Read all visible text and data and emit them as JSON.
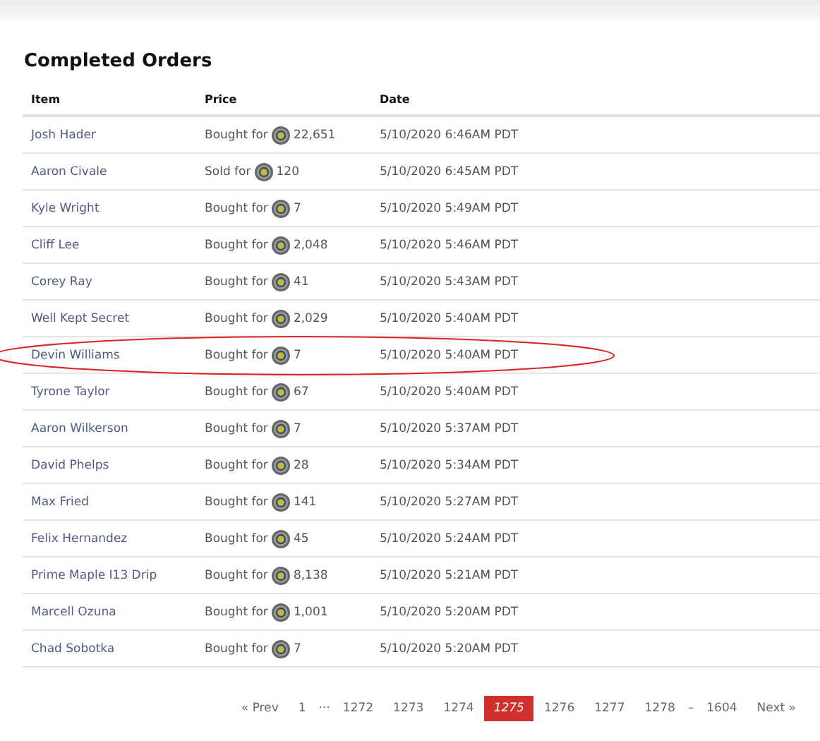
{
  "title": "Completed Orders",
  "table": {
    "columns": [
      "Item",
      "Price",
      "Date"
    ],
    "rows": [
      {
        "item": "Josh Hader",
        "action": "Bought for",
        "amount": "22,651",
        "date": "5/10/2020 6:46AM PDT",
        "highlighted": false
      },
      {
        "item": "Aaron Civale",
        "action": "Sold for",
        "amount": "120",
        "date": "5/10/2020 6:45AM PDT",
        "highlighted": false
      },
      {
        "item": "Kyle Wright",
        "action": "Bought for",
        "amount": "7",
        "date": "5/10/2020 5:49AM PDT",
        "highlighted": false
      },
      {
        "item": "Cliff Lee",
        "action": "Bought for",
        "amount": "2,048",
        "date": "5/10/2020 5:46AM PDT",
        "highlighted": false
      },
      {
        "item": "Corey Ray",
        "action": "Bought for",
        "amount": "41",
        "date": "5/10/2020 5:43AM PDT",
        "highlighted": false
      },
      {
        "item": "Well Kept Secret",
        "action": "Bought for",
        "amount": "2,029",
        "date": "5/10/2020 5:40AM PDT",
        "highlighted": false
      },
      {
        "item": "Devin Williams",
        "action": "Bought for",
        "amount": "7",
        "date": "5/10/2020 5:40AM PDT",
        "highlighted": true
      },
      {
        "item": "Tyrone Taylor",
        "action": "Bought for",
        "amount": "67",
        "date": "5/10/2020 5:40AM PDT",
        "highlighted": false
      },
      {
        "item": "Aaron Wilkerson",
        "action": "Bought for",
        "amount": "7",
        "date": "5/10/2020 5:37AM PDT",
        "highlighted": false
      },
      {
        "item": "David Phelps",
        "action": "Bought for",
        "amount": "28",
        "date": "5/10/2020 5:34AM PDT",
        "highlighted": false
      },
      {
        "item": "Max Fried",
        "action": "Bought for",
        "amount": "141",
        "date": "5/10/2020 5:27AM PDT",
        "highlighted": false
      },
      {
        "item": "Felix Hernandez",
        "action": "Bought for",
        "amount": "45",
        "date": "5/10/2020 5:24AM PDT",
        "highlighted": false
      },
      {
        "item": "Prime Maple I13 Drip",
        "action": "Bought for",
        "amount": "8,138",
        "date": "5/10/2020 5:21AM PDT",
        "highlighted": false
      },
      {
        "item": "Marcell Ozuna",
        "action": "Bought for",
        "amount": "1,001",
        "date": "5/10/2020 5:20AM PDT",
        "highlighted": false
      },
      {
        "item": "Chad Sobotka",
        "action": "Bought for",
        "amount": "7",
        "date": "5/10/2020 5:20AM PDT",
        "highlighted": false
      }
    ]
  },
  "pagination": [
    {
      "label": "« Prev",
      "kind": "link",
      "selected": false
    },
    {
      "label": "1",
      "kind": "page",
      "selected": false
    },
    {
      "label": "···",
      "kind": "gap"
    },
    {
      "label": "1272",
      "kind": "page",
      "selected": false
    },
    {
      "label": "1273",
      "kind": "page",
      "selected": false
    },
    {
      "label": "1274",
      "kind": "page",
      "selected": false
    },
    {
      "label": "1275",
      "kind": "page",
      "selected": true
    },
    {
      "label": "1276",
      "kind": "page",
      "selected": false
    },
    {
      "label": "1277",
      "kind": "page",
      "selected": false
    },
    {
      "label": "1278",
      "kind": "page",
      "selected": false
    },
    {
      "label": "–",
      "kind": "gap"
    },
    {
      "label": "1604",
      "kind": "page",
      "selected": false
    },
    {
      "label": "Next »",
      "kind": "link",
      "selected": false
    }
  ]
}
